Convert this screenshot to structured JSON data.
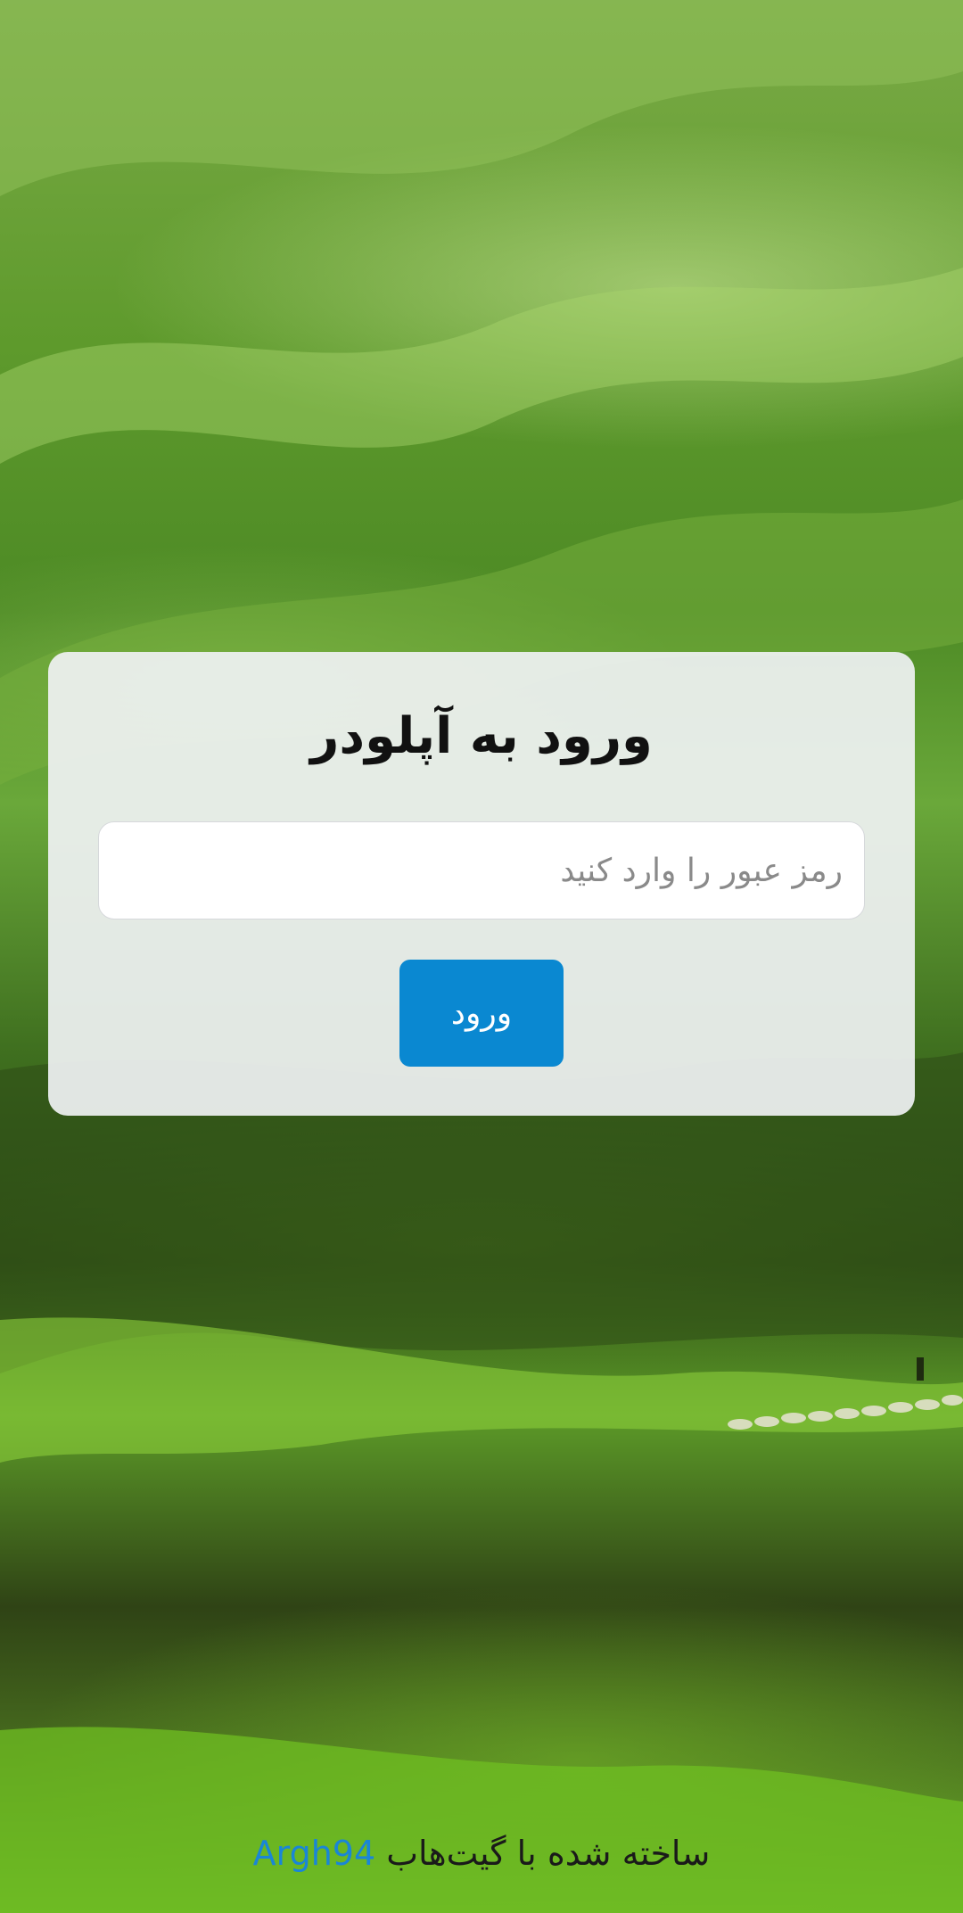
{
  "login": {
    "title": "ورود به آپلودر",
    "password_placeholder": "رمز عبور را وارد کنید",
    "submit_label": "ورود"
  },
  "footer": {
    "text": "ساخته شده با گیت‌هاب",
    "author_link": "Argh94"
  },
  "colors": {
    "accent": "#0a88d1",
    "link": "#1a86d6",
    "card_bg": "#f0f2f4"
  },
  "background": {
    "scene": "green-hills-landscape"
  }
}
